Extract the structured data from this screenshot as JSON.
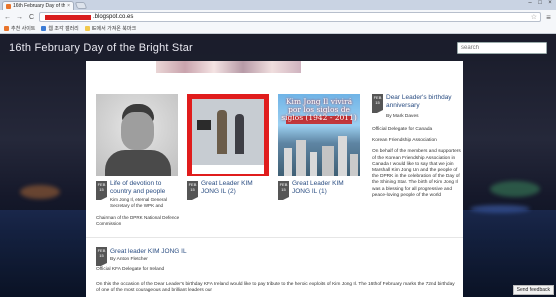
{
  "browser": {
    "tab_title": "16th February Day of the",
    "tab_close": "×",
    "window_controls": [
      "–",
      "□",
      "×"
    ],
    "back": "←",
    "forward": "→",
    "reload": "C",
    "url_prefix": "",
    "url_host": ".blogspot.co.es",
    "menu": "≡",
    "bookmarks": [
      {
        "label": "추천 사이트",
        "color": "#e8742c"
      },
      {
        "label": "웹 조각 갤러리",
        "color": "#3a7bd5"
      },
      {
        "label": "IE에서 가져온 북마크",
        "color": "#f2c94c"
      }
    ]
  },
  "blog": {
    "title": "16th February Day of the Bright Star",
    "search_placeholder": "search"
  },
  "cards": [
    {
      "month": "FEB",
      "day": "15",
      "title": "Life of devotion to country and people",
      "excerpt": "Kim Jong Il, eternal General Secretary of the WPK and\n\nChairman of the DPRK National Defence Commission"
    },
    {
      "month": "FEB",
      "day": "15",
      "title": "Great Leader KIM JONG IL (2)",
      "excerpt": ""
    },
    {
      "month": "FEB",
      "day": "15",
      "title": "Great Leader KIM JONG IL (1)",
      "excerpt": "",
      "image_text": "Kim Jong Il vivirá por los siglos de siglos (1942 - 2011)"
    }
  ],
  "sidebar_post": {
    "month": "FEB",
    "day": "15",
    "title": "Dear Leader's birthday anniversary",
    "author": "By Mark Daves",
    "paragraphs": [
      "Official Delegate for Canada",
      "Korean Friendship Association",
      "On behalf of the members and supporters of the Korean Friendship Association in Canada I would like to say that we join Marshall Kim Jong Un and the people of the DPRK in the celebration of the Day of the Shining Star.  The birth of Kim Jong Il was a blessing for all progressive and peace-loving people of the world"
    ]
  },
  "post2": {
    "month": "FEB",
    "day": "15",
    "title": "Great leader KIM JONG IL",
    "author": "By Anton Fletcher",
    "paragraphs": [
      "Official KFA Delegate for Ireland",
      "On this the occasion of the Dear Leader's birthday KFA Ireland would like to pay tribute to the heroic exploits of Kim Jong Il. The 16thof February marks the 72nd birthday of one of the most courageous and brilliant leaders our"
    ]
  },
  "feedback_label": "Send feedback"
}
